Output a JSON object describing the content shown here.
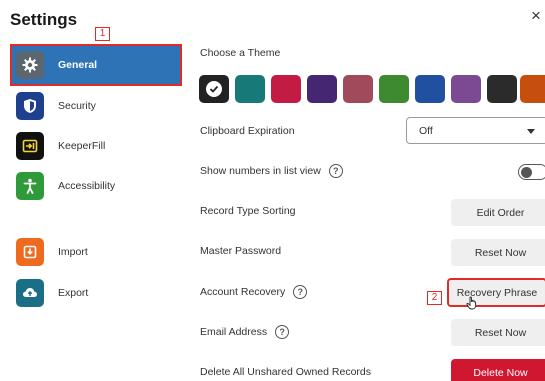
{
  "window": {
    "title": "Settings",
    "close_label": "×"
  },
  "annotations": {
    "step1": "1",
    "step2": "2"
  },
  "sidebar": {
    "items": [
      {
        "label": "General",
        "icon": "gear-icon",
        "color": "#5c6670",
        "selected": true
      },
      {
        "label": "Security",
        "icon": "shield-icon",
        "color": "#1f3f8f"
      },
      {
        "label": "KeeperFill",
        "icon": "keeperfill-icon",
        "color": "#111111"
      },
      {
        "label": "Accessibility",
        "icon": "accessibility-icon",
        "color": "#2f9a3a"
      },
      {
        "label": "Import",
        "icon": "import-icon",
        "color": "#ee6a1f"
      },
      {
        "label": "Export",
        "icon": "export-icon",
        "color": "#1a6f86"
      }
    ]
  },
  "colors": {
    "accent": "#2e73b5",
    "highlight": "#e02b2b",
    "danger": "#cf1730"
  },
  "theme": {
    "label": "Choose a Theme",
    "swatches": [
      "#222222",
      "#177a78",
      "#c31c44",
      "#452672",
      "#a14a5c",
      "#3d8a30",
      "#2150a0",
      "#7c4a93",
      "#2b2b2b",
      "#c64f0e"
    ],
    "selected_index": 0
  },
  "clipboard": {
    "label": "Clipboard Expiration",
    "value": "Off"
  },
  "show_numbers": {
    "label": "Show numbers in list view",
    "help": "?",
    "enabled": false
  },
  "record_sorting": {
    "label": "Record Type Sorting",
    "button": "Edit Order"
  },
  "master_password": {
    "label": "Master Password",
    "button": "Reset Now"
  },
  "account_recovery": {
    "label": "Account Recovery",
    "help": "?",
    "button": "Recovery Phrase"
  },
  "email": {
    "label": "Email Address",
    "help": "?",
    "button": "Reset Now"
  },
  "delete_records": {
    "label": "Delete All Unshared Owned Records",
    "button": "Delete Now"
  }
}
